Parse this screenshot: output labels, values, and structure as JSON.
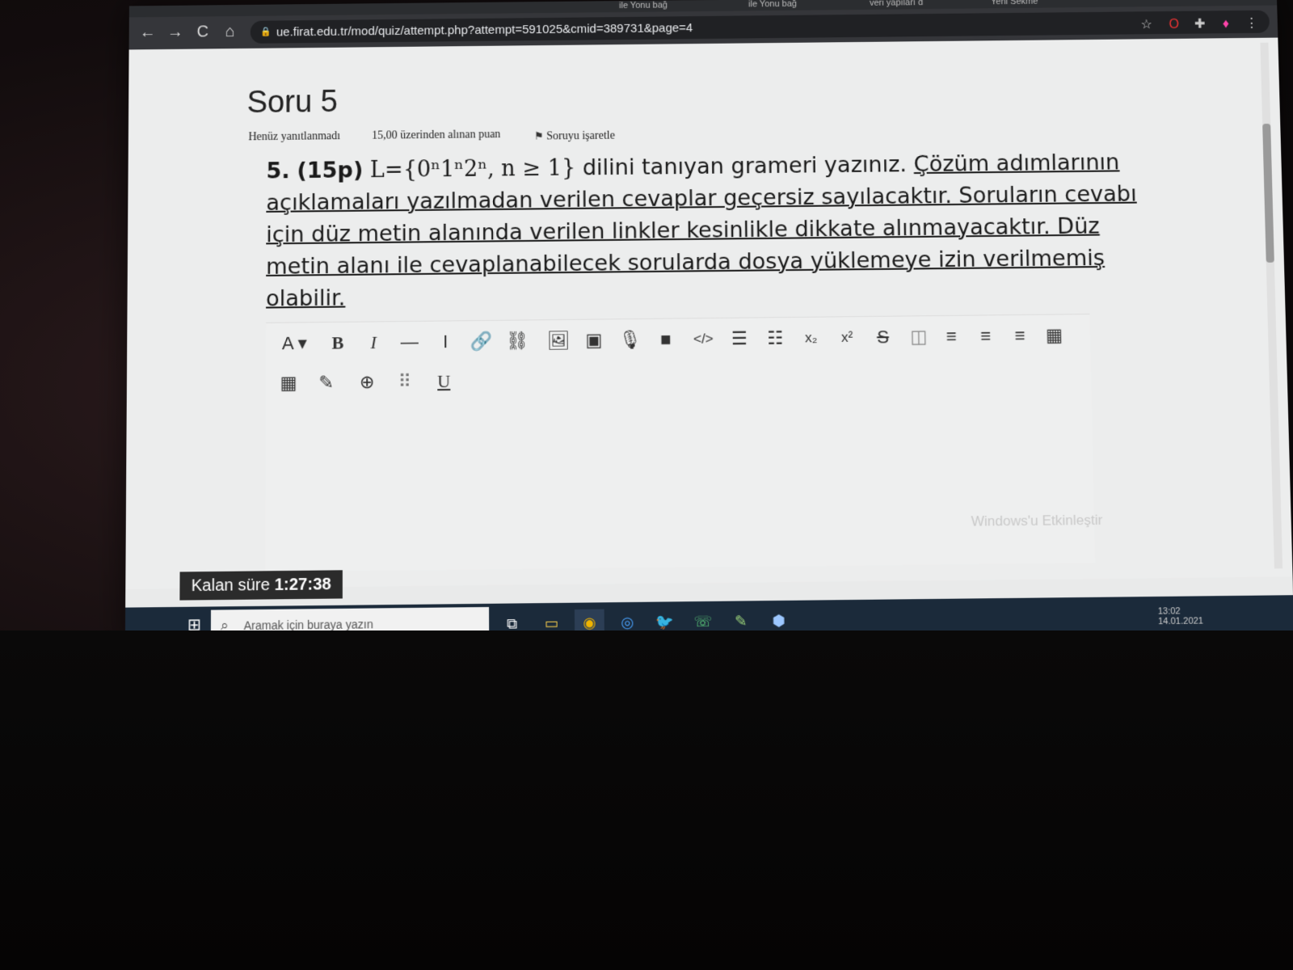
{
  "browser": {
    "tabs": [
      "ile Yonu bağ",
      "ile Yonu bağ",
      "veri yapıları d",
      "Yeni Sekme"
    ],
    "url": "ue.firat.edu.tr/mod/quiz/attempt.php?attempt=591025&cmid=389731&page=4",
    "nav": {
      "back": "←",
      "forward": "→",
      "reload": "C",
      "home": "⌂"
    },
    "extensions": [
      "☆",
      "O",
      "✚",
      "♦",
      "⋮"
    ]
  },
  "question": {
    "title": "Soru 5",
    "status": "Henüz yanıtlanmadı",
    "points_info": "15,00 üzerinden alınan puan",
    "flag_label": "Soruyu işaretle",
    "number": "5.",
    "points": "(15p)",
    "formula": "L={0ⁿ1ⁿ2ⁿ, n ≥ 1}",
    "text_plain": "dilini tanıyan grameri yazınız.",
    "text_underlined_1": "Çözüm adımlarının açıklamaları yazılmadan verilen cevaplar geçersiz sayılacaktır. Soruların cevabı için düz metin alanında verilen linkler kesinlikle dikkate alınmayacaktır. Düz metin alanı ile cevaplanabilecek sorularda dosya yüklemeye izin verilmemiş olabilir."
  },
  "editor_toolbar": {
    "row1": [
      "A ▾",
      "B",
      "I",
      "—",
      "I",
      "🔗",
      "⛓",
      "🖼",
      "▣",
      "🎙",
      "■",
      "</>",
      "☰",
      "☷",
      "x₂",
      "x²",
      "S",
      "◫",
      "≡",
      "≡",
      "≡",
      "▦"
    ],
    "row2": [
      "▦",
      "✎",
      "⊕",
      "⠿",
      "U"
    ]
  },
  "timer": {
    "label": "Kalan süre",
    "value": "1:27:38"
  },
  "watermark": "Windows'u Etkinleştir",
  "taskbar": {
    "start_icon": "⊞",
    "search_placeholder": "Aramak için buraya yazın",
    "apps": [
      "⧉",
      "▭",
      "◉",
      "◎",
      "🐦",
      "☏",
      "✎",
      "⬢"
    ],
    "tray_time": "13:02",
    "tray_date": "14.01.2021"
  }
}
